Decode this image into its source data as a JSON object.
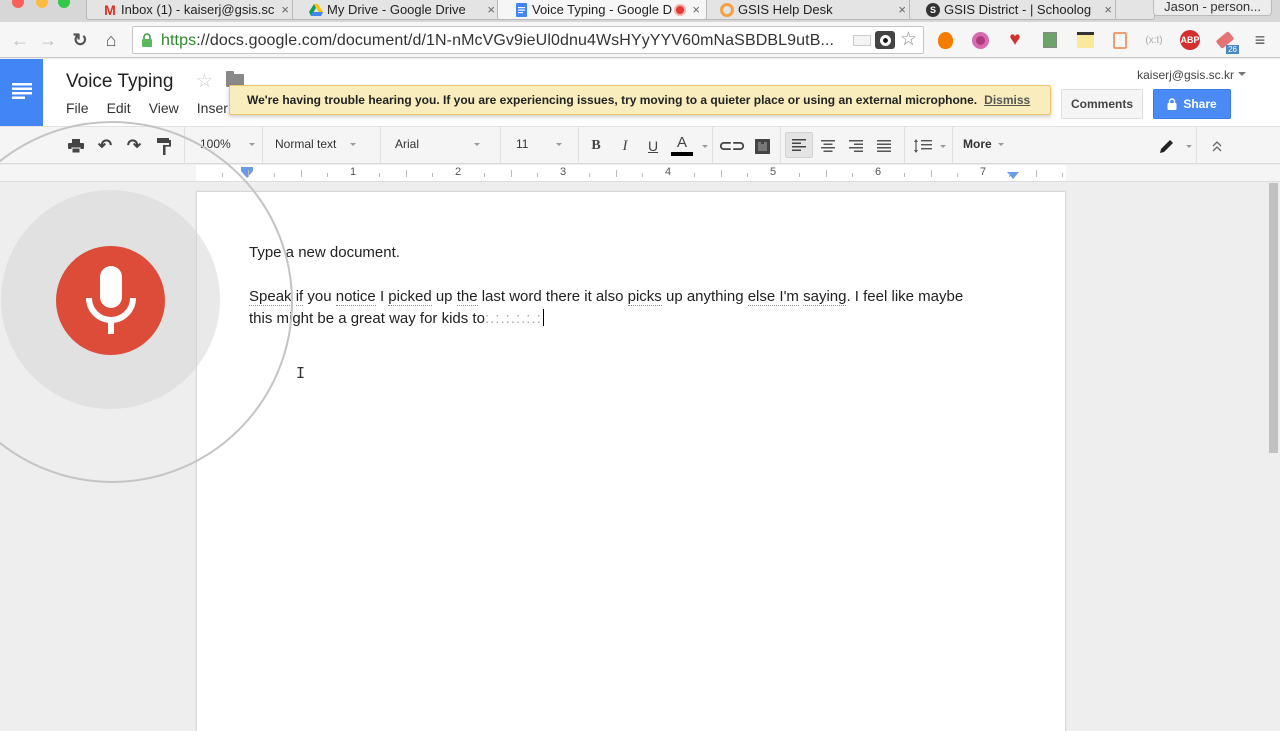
{
  "browser": {
    "tabs": [
      {
        "title": "Inbox (1) - kaiserj@gsis.sc",
        "icon": "gmail-icon",
        "active": false
      },
      {
        "title": "My Drive - Google Drive",
        "icon": "google-drive-icon",
        "active": false
      },
      {
        "title": "Voice Typing - Google D",
        "icon": "google-docs-icon",
        "active": true,
        "recording": true
      },
      {
        "title": "GSIS Help Desk",
        "icon": "help-desk-icon",
        "active": false
      },
      {
        "title": "GSIS District - | Schoolog",
        "icon": "schoology-icon",
        "active": false
      }
    ],
    "tab_close_glyph": "×",
    "profile": "Jason - person...",
    "url_scheme": "https",
    "url_rest": "://docs.google.com/document/d/1N-nMcVGv9ieUl0dnu4WsHYyYYV60mNaSBDBL9utB...",
    "extensions": [
      "camera-blocked-icon",
      "eye-extension-icon",
      "bookmark-star-icon",
      "hola-flame-icon",
      "aperture-extension-icon",
      "heart-plus-icon",
      "screen-capture-icon",
      "sticky-note-icon",
      "clipboard-icon",
      "code-extension-icon",
      "adblock-plus-icon",
      "eraser-icon",
      "chrome-menu-icon"
    ],
    "adblock_label": "ABP",
    "eraser_badge": "26"
  },
  "docs": {
    "title": "Voice Typing",
    "menu": [
      "File",
      "Edit",
      "View",
      "Inser"
    ],
    "account": "kaiserj@gsis.sc.kr",
    "comments_label": "Comments",
    "share_label": "Share",
    "banner": {
      "message": "We're having trouble hearing you. If you are experiencing issues, try moving to a quieter place or using an external microphone.",
      "dismiss_label": "Dismiss"
    },
    "toolbar": {
      "zoom": "100%",
      "style": "Normal text",
      "font": "Arial",
      "size": "11",
      "bold": "B",
      "italic": "I",
      "underline": "U",
      "text_color": "A",
      "more_label": "More"
    },
    "ruler": {
      "numbers": [
        "1",
        "2",
        "3",
        "4",
        "5",
        "6",
        "7"
      ]
    },
    "document": {
      "line1": "Type a new document.",
      "line2_segments": [
        {
          "text": "Speak",
          "flag": true
        },
        {
          "text": " ",
          "flag": false
        },
        {
          "text": "if",
          "flag": true
        },
        {
          "text": " you ",
          "flag": false
        },
        {
          "text": "notice",
          "flag": true
        },
        {
          "text": " I ",
          "flag": false
        },
        {
          "text": "picked",
          "flag": true
        },
        {
          "text": " up ",
          "flag": false
        },
        {
          "text": "the",
          "flag": true
        },
        {
          "text": " last word there it also ",
          "flag": false
        },
        {
          "text": "picks",
          "flag": true
        },
        {
          "text": " up anything ",
          "flag": false
        },
        {
          "text": "else I'm",
          "flag": true
        },
        {
          "text": " ",
          "flag": false
        },
        {
          "text": "saying",
          "flag": true
        },
        {
          "text": ". I feel like maybe",
          "flag": false
        }
      ],
      "line3": "this might be a great way for kids to",
      "interim_marker": ":.:.:.:.:.:"
    },
    "voice_typing": {
      "state": "listening",
      "mic_color": "#dd4b39"
    }
  },
  "colors": {
    "docs_blue": "#4285f4",
    "share_blue": "#4a8af4",
    "banner_bg": "#f9edbe",
    "banner_border": "#f0c36d"
  }
}
